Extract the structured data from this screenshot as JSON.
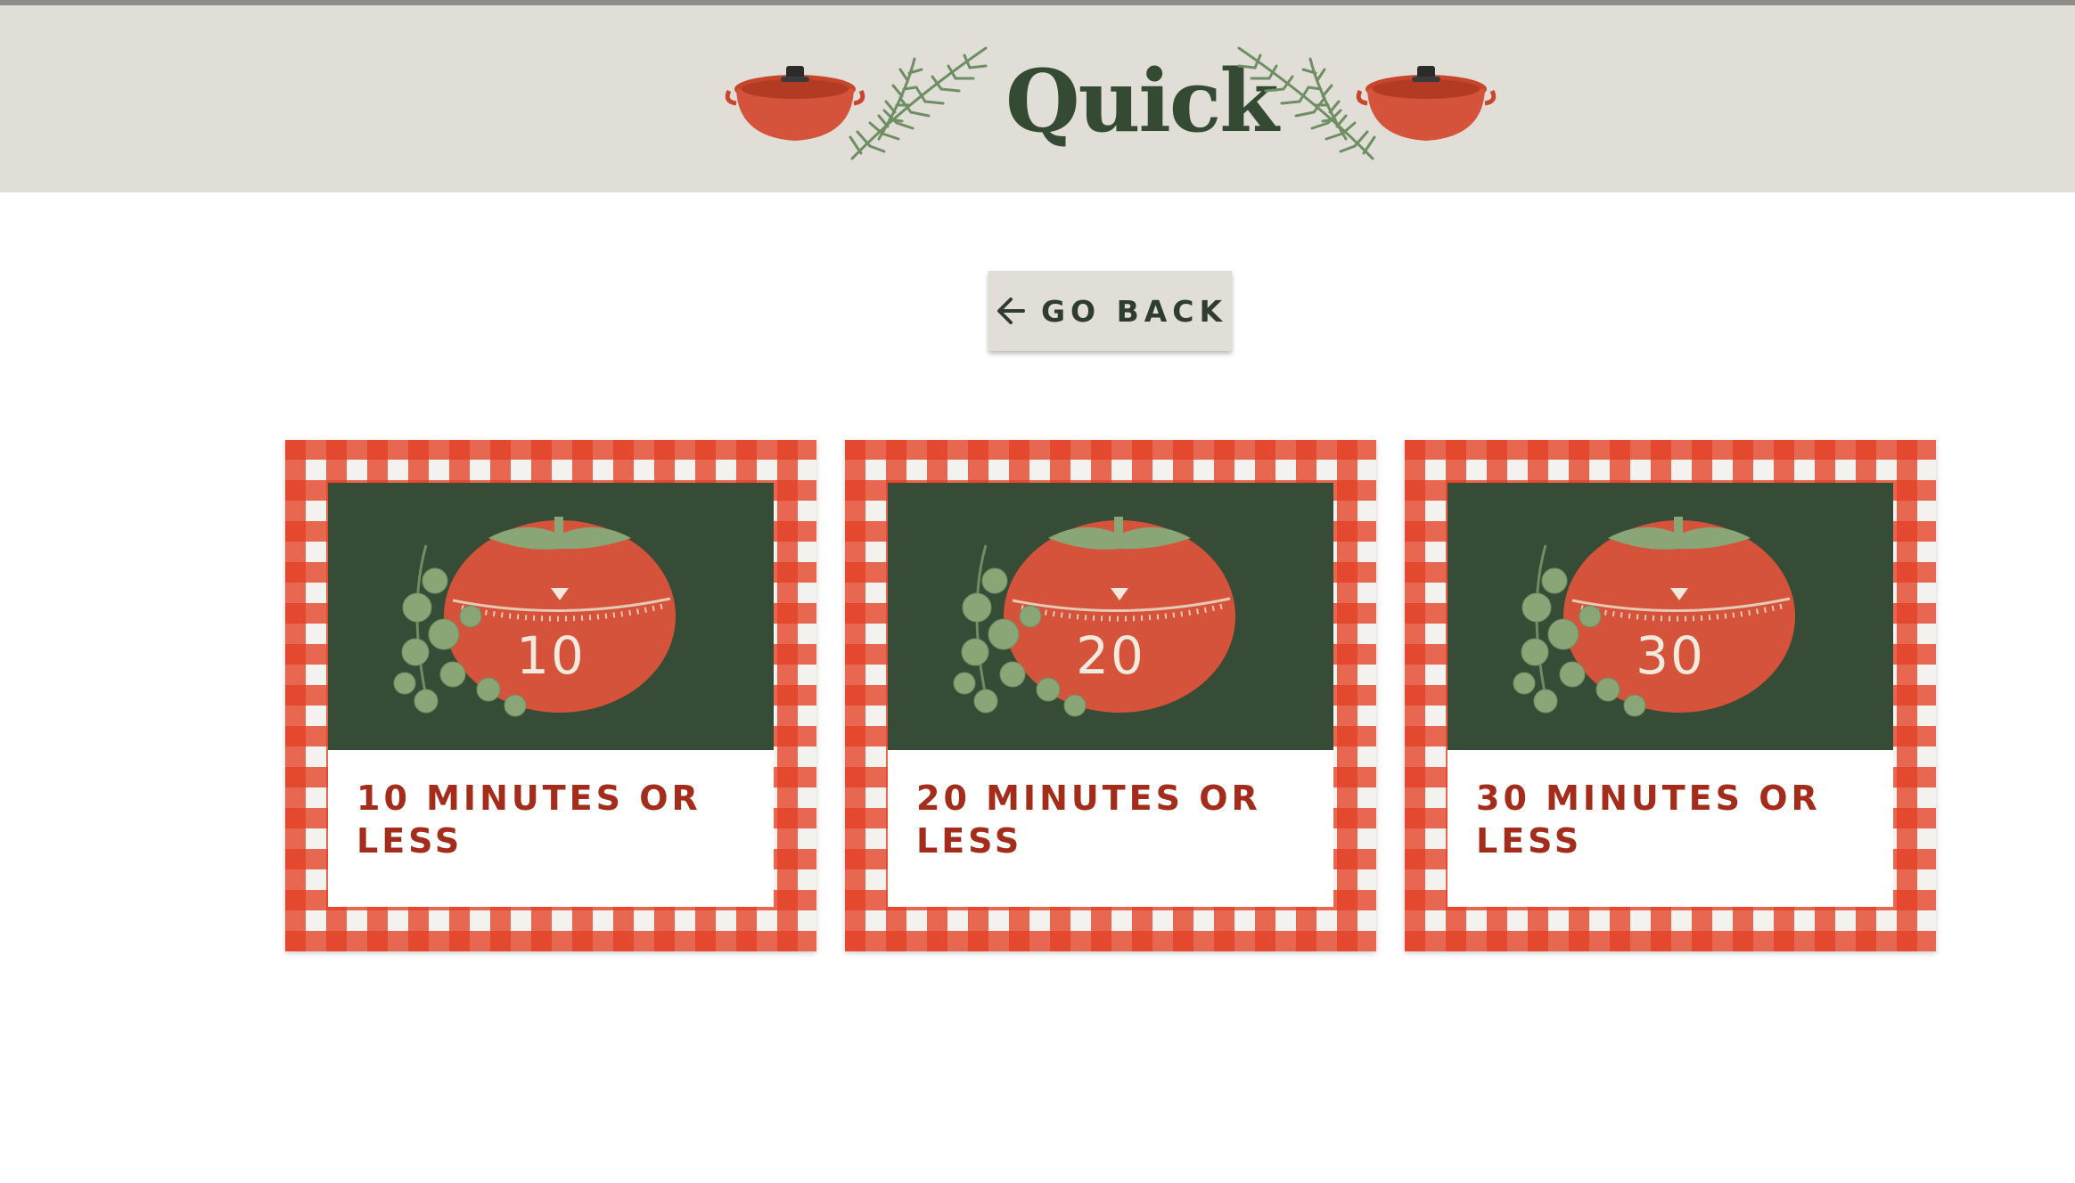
{
  "header": {
    "title": "Quick",
    "left_icons": [
      "dutch-oven-icon",
      "rosemary-sprig-icon"
    ],
    "right_icons": [
      "rosemary-sprig-icon",
      "dutch-oven-icon"
    ]
  },
  "back_button": {
    "label": "GO BACK",
    "icon": "arrow-left-icon"
  },
  "cards": [
    {
      "timer_number": "10",
      "label": "10 MINUTES OR LESS",
      "image_icon": "tomato-timer-icon"
    },
    {
      "timer_number": "20",
      "label": "20 MINUTES OR LESS",
      "image_icon": "tomato-timer-icon"
    },
    {
      "timer_number": "30",
      "label": "30 MINUTES OR LESS",
      "image_icon": "tomato-timer-icon"
    }
  ],
  "colors": {
    "header_bg": "#e1ded7",
    "title_green": "#344a33",
    "label_red": "#a32c1b",
    "gingham_red": "#e34024",
    "card_image_bg": "#374c36",
    "tomato": "#d4533a"
  }
}
